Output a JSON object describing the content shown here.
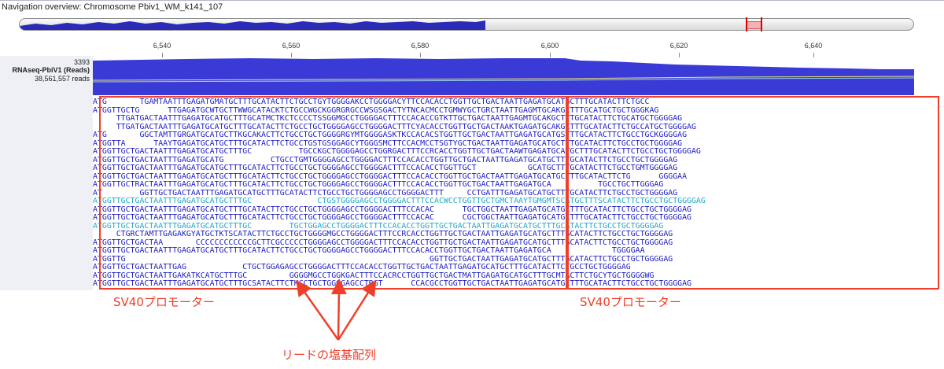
{
  "navigation": {
    "title": "Navigation overview: Chromosome Pbiv1_WM_k141_107"
  },
  "ruler": {
    "ticks": [
      {
        "label": "6,540"
      },
      {
        "label": "6,560"
      },
      {
        "label": "6,580"
      },
      {
        "label": "6,600"
      },
      {
        "label": "6,620"
      },
      {
        "label": "6,640"
      }
    ]
  },
  "track": {
    "coverage_max": "3393",
    "name": "RNAseq-PbiV1 (Reads)",
    "read_count": "38,561,557 reads"
  },
  "colors": {
    "coverage": "#3a3ad6",
    "read_text": "#1c1cc4",
    "mismatch_bg": "#e6e0c6",
    "annotation_red": "#ef3f2a",
    "track_header_bg": "#eef0f5"
  },
  "reads": [
    "ATG       TGAMTAATTTGAGATGMATGCTTTGCATACTTCTGCCTGYTGGGGAKCCTGGGGACYTTCCACACCTGGTTGCTGACTAATTGAGATGCATGCTTTGCATACTTCTGCC",
    "ATGGTTGCTG      TTGAGATGCWTGCTTWWGCATACKTCTGCCWGCKGGRGRGCCWSGSGACTYTNCACMCCTGMWYGCTGRCTAATTGAGMTGCAKGCTTTGCATGCTGCTGGGKAG",
    "     TTGATGACTAATTTGAGATGCATGCTTTGCATMCTKCTCCCCTSSGGMGCCTGGGGACTTTCCACACCGTKTTGCTGACTAATTGAGMTGCAKGCTTTGCATACTTCTGCATGCTGGGGAG",
    "     TTGATGACTAATTTGAGATGCATGCTTTGCATACTTCTGCCTGCTGGGGAGCCTGGGGACTTTCYACACCTGGTTGCTGACTAAKTGAGATGCAKGCTTTGCATACTTCTGCCATGCTGGGGAG",
    "ATG       GGCTAMTTGRGATGCATGCTTKGCAKACTTCTGCCTGCTGGGGRGYMTGGGGASKTKCCACACSTGGTTGCTGACTAATTGAGATGCATGSTTTGCATACTTCTGCCTGCKGGGGAG",
    "ATGGTTA      TAAYTGAGATGCATGCTTTGCATACTTCTGCCTGSTGSGGAGCYTGGGSMCTTCCACMCCTSGTYGCTGACTAATTGAGATGCATGCTTTGCATACTTCTGCCTGCTGGGGAG",
    "ATGGTTGCTGACTAATTTGAGATGCATGCTTTGC          TGCCKGCTGGGGAGCCTGGRGACTTTCCRCACCTGGTTGCTGACTAAWTGAGATGCATGCTTTGCATACTTCTGCCTGCTGGGGAG",
    "ATGGTTGCTGACTAATTTGAGATGCATG          CTGCCTGMTGGGGAGCCTGGGGACTTTCCACACCTGGTTGCTGACTAATTGAGATGCATGCTTTGCATACTTCTGCCTGCTGGGGAG",
    "ATGGTTGCTGACTAATTTGAGATGCATGCTTTGCATACTTCTGCCTGCTGGGGAGCCTGGGGACTTTCCACACCTGGTTGCT           GCATGCTTTGCATACTTCTGCCTGMTGGGGAG",
    "ATGGTTGCTGACTAATTTGAGATGCATGCTTTGCATACTTCTGCCTGCTGGGGAGCCTGGGGACTTTCCACACCTGGTTGCTGACTAATTGAGATGCATGCTTTGCATACTTCTG      GGGGAA",
    "ATGGTTGCTRACTAATTTGAGATGCATGCTTTGCATACTTCTGCCTGCTGGGGAGCCTGGGGACTTTCCACACCTGGTTGCTGACTAATTGAGATGCA          TGCCTGCTTGGGAG",
    "AT        GGTTGCTGACTAATTTGAGATGCATGCTTTGCATACTTCTGCCTGCTGGGGAGCCTGGGGACTTT     CCTGATTTGAGATGCATGCTTTGCATACTTCTGCCTGCTGGGGAG",
    "ATGGTTGCTGACTAATTTGAGATGCATGCTTTGC              CTGSTGGGGAGCCTGGGGACTTTCCACWCCTGGTTGCTGMCTAAYTGMGMTSCATGCTTTSCATACTTCTGCCTGCTGGGGAG",
    "ATGGTTGCTGACTAATTTGAGATGCATGCTTTGCATACTTCTGCCTGCTGGGGAGCCTGGGGACTTTCCACAC      TGCTGGCTAATTGAGATGCATGCTTTGCATACTTCTGCCTGCTGGGGAG",
    "ATGGTTGCTGACTAATTTGAGATGCATGCTTTGCATACTTCTGCCTGCTGGGGAGCCTGGGGACTTTCCACAC      CGCTGGCTAATTGAGATGCATGCTTTGCATACTTCTGCCTGCTGGGGAG",
    "ATGGTTGCTGACTAATTTGAGATGCATGCTTTGC        TGCTGGAGCCTGGGGACTTTCCACACCTGGTTGCTGACTAATTGAGATGCATGCTTTGCATACTTCTGCCTGCTGGGGAG",
    "     CTGRCTAMTTGAGAKGYATGCTKTSCATACTTCTGCCTGCTGGGGMGCCTGGGGACTTTCCRCACCTGGTTGCTGACTAATTGAGATGCATGCTTTGCATACTTCTGCCTGCTGGGGAG",
    "ATGGTTGCTGACTAA       CCCCCCCCCCCCGCTTCGCCCCCTGGGGAGCCTGGGGACTTTCCACACCTGGTTGCTGACTAATTGAGATGCATGCTTTGCATACTTCTGCCTGCTGGGGAG",
    "ATGGTTGCTGACTAATTTGAGATGCATGCTTTGCATACTTCTGCCTGCTGGGGAGCCTGGGGACTTTCCACACCTGGTTGCTGACTAATTGAGATGCA             TGGGGAA",
    "ATGGTTG                                                                 GGTTGCTGACTAATTGAGATGCATGCTTTGCATACTTCTGCCTGCTGGGGAG",
    "ATGGTTGCTGACTAATTGAG            CTGCTGGAGAGCCTGGGGACTTTCCACACCTGGTTGCTGACTAATTGAGATGCATGCTTTGCATACTTCTGCCTGCTGGGGAG",
    "ATGGTTGCTGACTAATTGAKATKCATGCTTTGC         GGGGMGCCTGGKGACTTTCCACRCCTGGTTGCTGACTMATTGAGATGCATGCTTTGCMTACTTCTGCYTGCTGGGGWG",
    "ATGGTTGCTGACTAATTTGAGATGCATGCTTTGCSATACTTCTKCCTGCTGGGGAGCCTRGT      CCACGCCTGGTTGCTGACTAATTGAGATGCATGCTTTGCATACTTCTGCCTGCTGGGGAG"
  ],
  "annotations": {
    "sv40_left": "SV40プロモーター",
    "sv40_right": "SV40プロモーター",
    "read_sequences": "リードの塩基配列"
  }
}
